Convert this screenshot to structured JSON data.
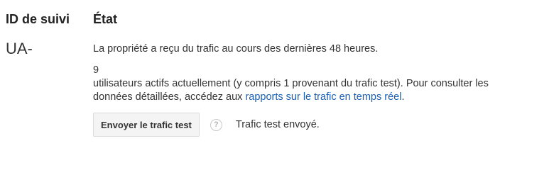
{
  "tracking": {
    "header": "ID de suivi",
    "id_value": "UA-"
  },
  "status": {
    "header": "État",
    "message": "La propriété a reçu du trafic au cours des dernières 48 heures.",
    "active_users_count": "9",
    "active_users_text_line1": "utilisateurs actifs actuellement (y compris 1 provenant du trafic test). Pour consulter les",
    "active_users_text_line2": "données détaillées,  accédez aux",
    "realtime_link": "rapports sur le trafic en temps réel",
    "period": "."
  },
  "actions": {
    "send_test_button": "Envoyer le trafic test",
    "help_icon": "?",
    "sent_status": "Trafic test envoyé."
  },
  "colors": {
    "link": "#1a5fb4",
    "text": "#333333",
    "button_bg": "#f4f4f4"
  }
}
